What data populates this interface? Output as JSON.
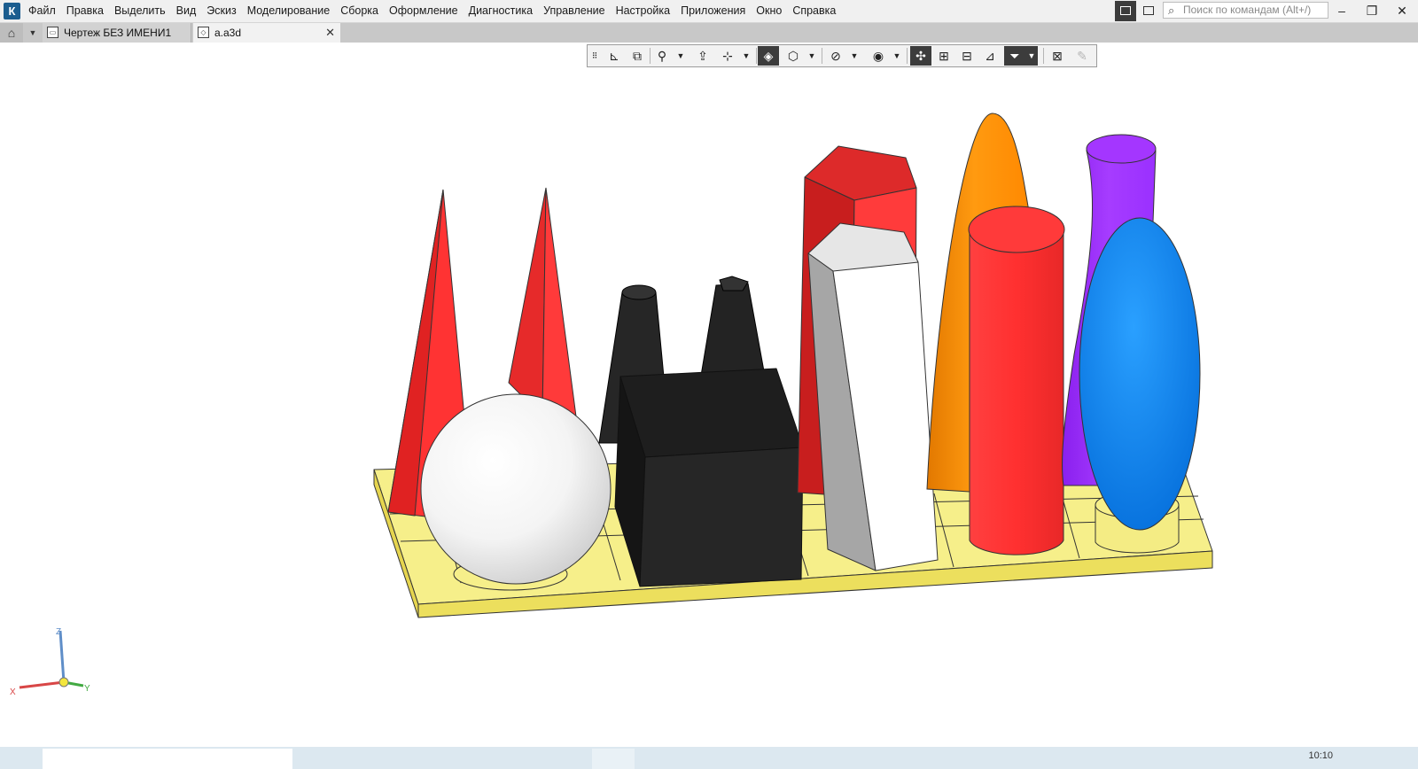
{
  "menubar": {
    "logo": "К",
    "items": [
      "Файл",
      "Правка",
      "Выделить",
      "Вид",
      "Эскиз",
      "Моделирование",
      "Сборка",
      "Оформление",
      "Диагностика",
      "Управление",
      "Настройка",
      "Приложения",
      "Окно",
      "Справка"
    ],
    "search_placeholder": "Поиск по командам (Alt+/)"
  },
  "tabs": [
    {
      "label": "Чертеж БЕЗ ИМЕНИ1"
    },
    {
      "label": "a.a3d"
    }
  ],
  "axes": {
    "x": "X",
    "y": "Y",
    "z": "Z"
  },
  "scene_colors": {
    "base": "#f3ec8a",
    "red": "#ff3333",
    "black": "#222222",
    "gray": "#a6a6a6",
    "white": "#ffffff",
    "orange": "#ff8c00",
    "purple": "#9d33ff",
    "blue": "#0a84f0"
  },
  "status": {
    "clock": "10:10"
  }
}
